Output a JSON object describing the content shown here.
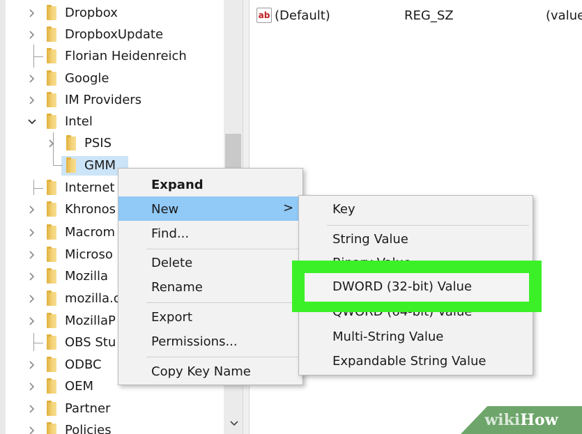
{
  "tree": {
    "items": [
      {
        "label": "Dropbox"
      },
      {
        "label": "DropboxUpdate"
      },
      {
        "label": "Florian Heidenreich"
      },
      {
        "label": "Google"
      },
      {
        "label": "IM Providers"
      },
      {
        "label": "Intel"
      },
      {
        "label": "PSIS"
      },
      {
        "label": "GMM"
      },
      {
        "label": "Internet"
      },
      {
        "label": "Khronos"
      },
      {
        "label": "Macrom"
      },
      {
        "label": "Microso"
      },
      {
        "label": "Mozilla"
      },
      {
        "label": "mozilla.c"
      },
      {
        "label": "MozillaP"
      },
      {
        "label": "OBS Stu"
      },
      {
        "label": "ODBC"
      },
      {
        "label": "OEM"
      },
      {
        "label": "Partner"
      },
      {
        "label": "Policies"
      }
    ]
  },
  "values": {
    "row": {
      "icon": "ab",
      "name": "(Default)",
      "type": "REG_SZ",
      "data": "(value"
    }
  },
  "context_menu": {
    "expand": "Expand",
    "new": "New",
    "new_arrow": ">",
    "find": "Find...",
    "delete": "Delete",
    "rename": "Rename",
    "export": "Export",
    "permissions": "Permissions...",
    "copy_key_name": "Copy Key Name"
  },
  "submenu": {
    "key": "Key",
    "string_value": "String Value",
    "binary_value": "Binary Value",
    "dword_value": "DWORD (32-bit) Value",
    "qword_value": "QWORD (64-bit) Value",
    "multi_string_value": "Multi-String Value",
    "expandable_string_value": "Expandable String Value"
  },
  "watermark": {
    "part1": "wiki",
    "part2": "How"
  },
  "colors": {
    "highlight": "#91c9f7",
    "callout": "#3cf028",
    "folder": "#e8c05a"
  }
}
